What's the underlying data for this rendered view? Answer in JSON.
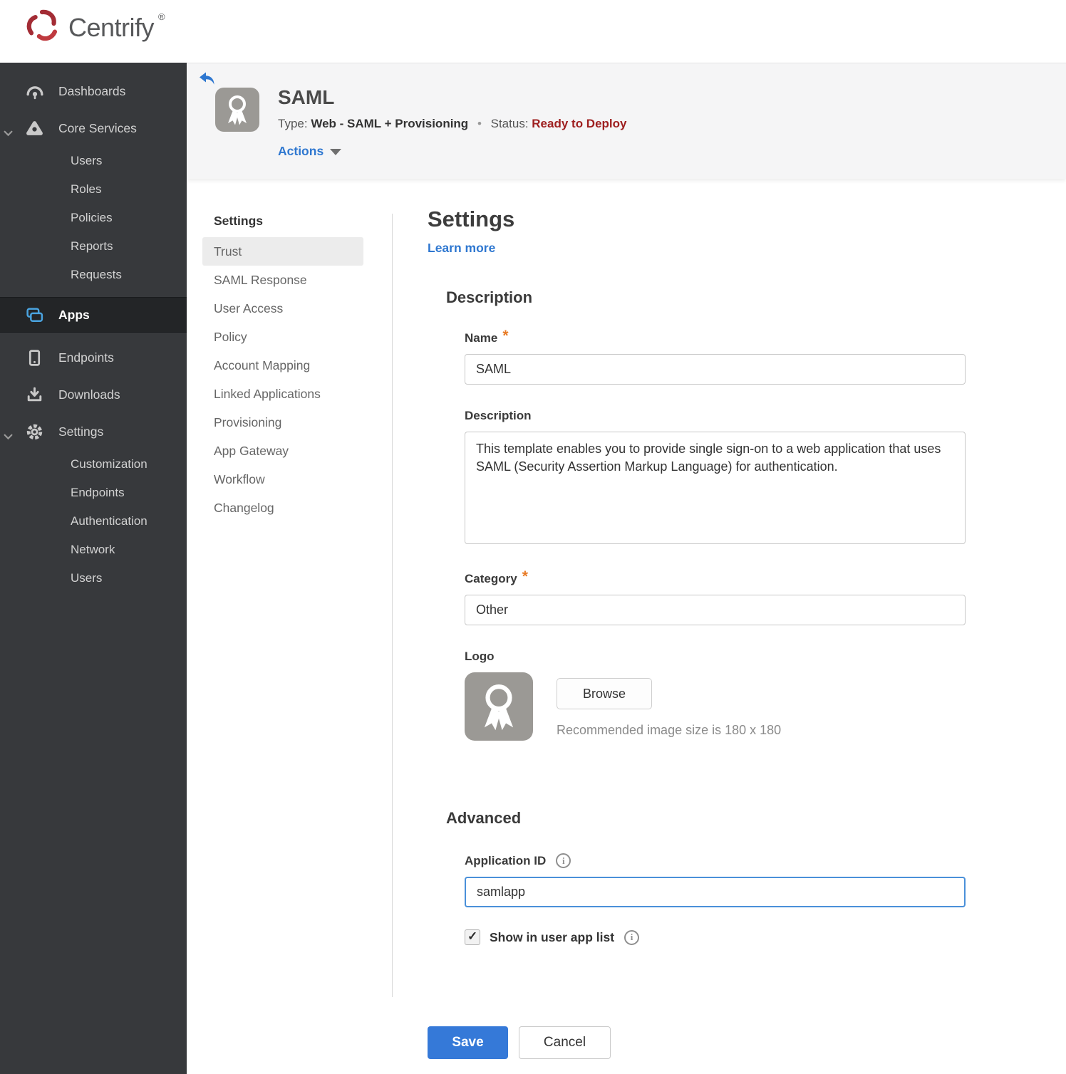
{
  "brand": {
    "name": "Centrify",
    "registered_mark": "®",
    "logo_icon": "centrify-swirl-icon",
    "logo_color": "#a32c35",
    "wordmark_color": "#57585a"
  },
  "sidebar": {
    "bg_color": "#37393c",
    "active_accent": "#4aa3df",
    "items": [
      {
        "label": "Dashboards",
        "icon": "gauge-icon"
      },
      {
        "label": "Core Services",
        "icon": "cluster-icon",
        "expanded": true
      },
      {
        "label": "Users"
      },
      {
        "label": "Roles"
      },
      {
        "label": "Policies"
      },
      {
        "label": "Reports"
      },
      {
        "label": "Requests"
      },
      {
        "label": "Apps",
        "icon": "apps-icon",
        "active": true
      },
      {
        "label": "Endpoints",
        "icon": "mobile-icon"
      },
      {
        "label": "Downloads",
        "icon": "download-icon"
      },
      {
        "label": "Settings",
        "icon": "gear-icon",
        "expanded": true
      },
      {
        "label": "Customization"
      },
      {
        "label": "Endpoints"
      },
      {
        "label": "Authentication"
      },
      {
        "label": "Network"
      },
      {
        "label": "Users"
      }
    ]
  },
  "header": {
    "back_icon": "back-arrow-icon",
    "app_icon": "ribbon-award-icon",
    "app_name": "SAML",
    "type_label": "Type:",
    "type_value": "Web - SAML + Provisioning",
    "separator": "•",
    "status_label": "Status:",
    "status_value": "Ready to Deploy",
    "status_color": "#9e1f1f",
    "actions_label": "Actions"
  },
  "subnav": {
    "heading": "Settings",
    "items": [
      {
        "label": "Trust",
        "selected": true
      },
      {
        "label": "SAML Response"
      },
      {
        "label": "User Access"
      },
      {
        "label": "Policy"
      },
      {
        "label": "Account Mapping"
      },
      {
        "label": "Linked Applications"
      },
      {
        "label": "Provisioning"
      },
      {
        "label": "App Gateway"
      },
      {
        "label": "Workflow"
      },
      {
        "label": "Changelog"
      }
    ]
  },
  "main": {
    "title": "Settings",
    "learn_more_label": "Learn more",
    "required_marker": "*",
    "required_color": "#e87a24",
    "description_section": {
      "heading": "Description",
      "name_label": "Name",
      "name_value": "SAML",
      "description_label": "Description",
      "description_value": "This template enables you to provide single sign-on to a web application that uses SAML (Security Assertion Markup Language) for authentication.",
      "category_label": "Category",
      "category_value": "Other",
      "logo_label": "Logo",
      "logo_icon": "ribbon-award-icon",
      "browse_label": "Browse",
      "logo_hint": "Recommended image size is 180 x 180"
    },
    "advanced_section": {
      "heading": "Advanced",
      "application_id_label": "Application ID",
      "application_id_value": "samlapp",
      "application_id_focused": true,
      "info_icon": "info-icon",
      "checkbox_checked": true,
      "show_in_user_app_list_label": "Show in user app list"
    },
    "footer": {
      "save_label": "Save",
      "cancel_label": "Cancel",
      "save_color": "#3579d8"
    }
  }
}
